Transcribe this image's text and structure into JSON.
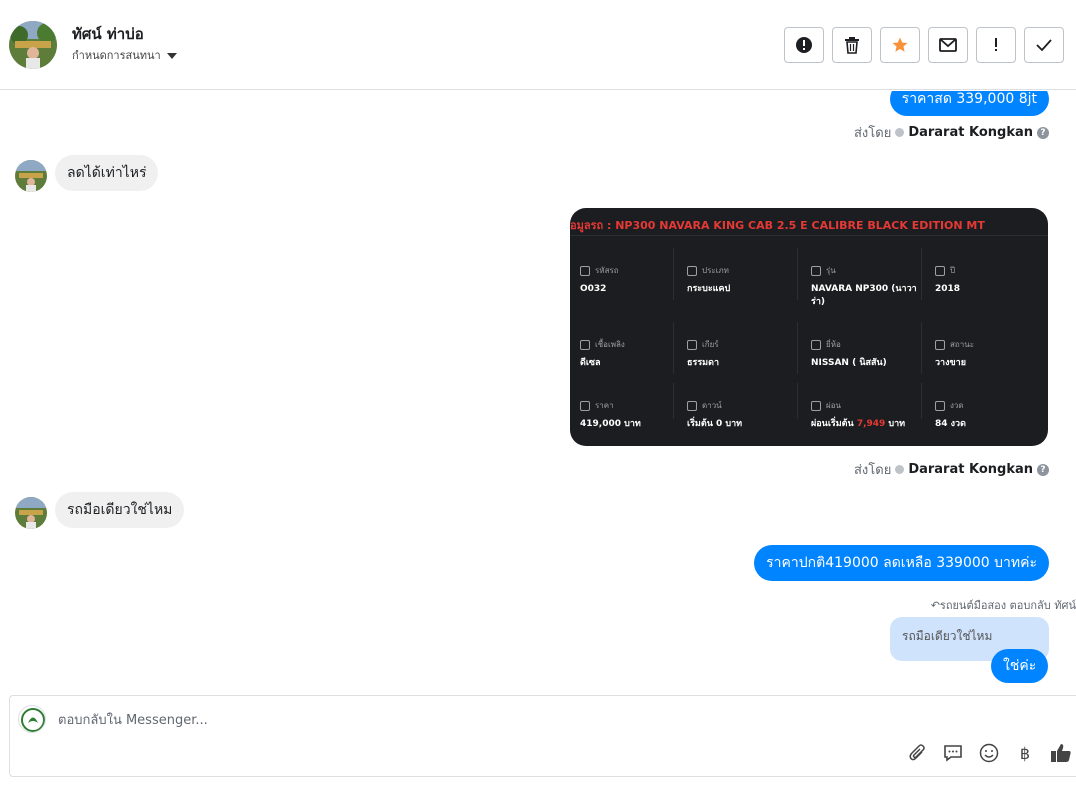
{
  "header": {
    "contact_name": "ทัศน์ ท่าบ่อ",
    "assign_label": "กำหนดการสนทนา",
    "actions": [
      {
        "name": "report-button",
        "icon": "alert-circle-icon",
        "color": "#1c1e21"
      },
      {
        "name": "delete-button",
        "icon": "trash-icon",
        "color": "#1c1e21"
      },
      {
        "name": "star-button",
        "icon": "star-icon",
        "color": "#f7923b"
      },
      {
        "name": "mark-unread-button",
        "icon": "envelope-icon",
        "color": "#1c1e21"
      },
      {
        "name": "follow-up-button",
        "icon": "exclamation-icon",
        "color": "#1c1e21"
      },
      {
        "name": "done-button",
        "icon": "check-icon",
        "color": "#1c1e21"
      }
    ]
  },
  "messages": {
    "m1_out": "ราคาสด 339,000 8jt",
    "sent_by_label": "ส่งโดย",
    "agent_name": "Dararat Kongkan",
    "m2_in": "ลดได้เท่าไหร่",
    "m3_in": "รถมือเดียวใช่ไหม",
    "m4_out": "ราคาปกติ419000 ลดเหลือ 339000 บาทค่ะ",
    "reply_meta": "รถยนต์มือสอง ตอบกลับ ทัศน์",
    "reply_quote": "รถมือเดียวใช่ไหม",
    "m5_out": "ใช่ค่ะ"
  },
  "car_card": {
    "title": "้อมูลรถ : NP300 NAVARA KING CAB 2.5 E CALIBRE BLACK EDITION MT",
    "rows": [
      [
        {
          "label": "รหัสรถ",
          "value": "O032"
        },
        {
          "label": "ประเภท",
          "value": "กระบะแคป"
        },
        {
          "label": "รุ่น",
          "value": "NAVARA NP300 (นาวาร่า)"
        },
        {
          "label": "ปี",
          "value": "2018"
        }
      ],
      [
        {
          "label": "เชื้อเพลิง",
          "value": "ดีเซล"
        },
        {
          "label": "เกียร์",
          "value": "ธรรมดา"
        },
        {
          "label": "ยี่ห้อ",
          "value": "NISSAN ( นิสสัน)"
        },
        {
          "label": "สถานะ",
          "value": "วางขาย"
        }
      ],
      [
        {
          "label": "ราคา",
          "value": "419,000 บาท"
        },
        {
          "label": "ดาวน์",
          "value": "เริ่มต้น 0 บาท"
        },
        {
          "label": "ผ่อน",
          "value_prefix": "ผ่อนเริ่มต้น ",
          "value_highlight": "7,949",
          "value_suffix": " บาท"
        },
        {
          "label": "งวด",
          "value": "84 งวด"
        }
      ]
    ]
  },
  "composer": {
    "placeholder": "ตอบกลับใน Messenger...",
    "tools": [
      "paperclip-icon",
      "speech-bubble-icon",
      "smiley-icon",
      "baht-icon",
      "thumbs-up-icon"
    ],
    "baht_symbol": "฿"
  },
  "colors": {
    "outgoing_bubble": "#0084ff",
    "incoming_bubble": "#f0f0f0",
    "quote_bg": "#cfe3fd",
    "star": "#f7923b",
    "card_bg": "#1c1d20",
    "card_accent": "#e53935"
  }
}
